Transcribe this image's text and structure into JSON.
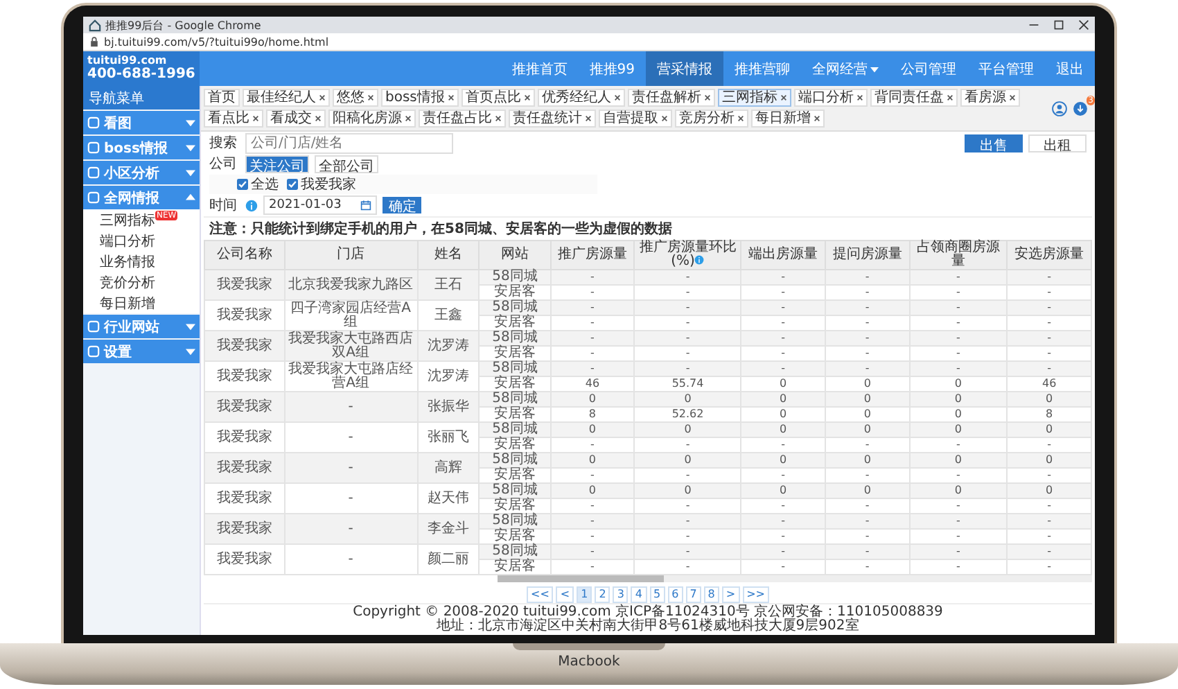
{
  "browser": {
    "title": "推推99后台 - Google Chrome",
    "url": "bj.tuitui99.com/v5/?tuitui99o/home.html"
  },
  "logo": {
    "brand": "tuitui99.com",
    "phone": "400-688-1996"
  },
  "nav": [
    {
      "label": "推推首页",
      "selected": false,
      "dropdown": false
    },
    {
      "label": "推推99",
      "selected": false,
      "dropdown": false
    },
    {
      "label": "营采情报",
      "selected": true,
      "dropdown": false
    },
    {
      "label": "推推营聊",
      "selected": false,
      "dropdown": false
    },
    {
      "label": "全网经营",
      "selected": false,
      "dropdown": true
    },
    {
      "label": "公司管理",
      "selected": false,
      "dropdown": false
    },
    {
      "label": "平台管理",
      "selected": false,
      "dropdown": false
    },
    {
      "label": "退出",
      "selected": false,
      "dropdown": false
    }
  ],
  "sidebar": {
    "title": "导航菜单",
    "items": [
      {
        "label": "看图",
        "expanded": false
      },
      {
        "label": "boss情报",
        "expanded": false
      },
      {
        "label": "小区分析",
        "expanded": false
      },
      {
        "label": "全网情报",
        "expanded": true,
        "children": [
          {
            "label": "三网指标",
            "badge": "NEW"
          },
          {
            "label": "端口分析"
          },
          {
            "label": "业务情报"
          },
          {
            "label": "竞价分析"
          },
          {
            "label": "每日新增"
          }
        ]
      },
      {
        "label": "行业网站",
        "expanded": false
      },
      {
        "label": "设置",
        "expanded": false
      }
    ]
  },
  "tabs": [
    {
      "label": "首页",
      "selected": false,
      "closable": false
    },
    {
      "label": "最佳经纪人",
      "selected": false,
      "closable": true
    },
    {
      "label": "悠悠",
      "selected": false,
      "closable": true
    },
    {
      "label": "boss情报",
      "selected": false,
      "closable": true
    },
    {
      "label": "首页点比",
      "selected": false,
      "closable": true
    },
    {
      "label": "优秀经纪人",
      "selected": false,
      "closable": true
    },
    {
      "label": "责任盘解析",
      "selected": false,
      "closable": true
    },
    {
      "label": "三网指标",
      "selected": true,
      "closable": true
    },
    {
      "label": "端口分析",
      "selected": false,
      "closable": true
    },
    {
      "label": "背同责任盘",
      "selected": false,
      "closable": true
    },
    {
      "label": "看房源",
      "selected": false,
      "closable": true
    },
    {
      "label": "看点比",
      "selected": false,
      "closable": true
    },
    {
      "label": "看成交",
      "selected": false,
      "closable": true
    },
    {
      "label": "阳稿化房源",
      "selected": false,
      "closable": true
    },
    {
      "label": "责任盘占比",
      "selected": false,
      "closable": true
    },
    {
      "label": "责任盘统计",
      "selected": false,
      "closable": true
    },
    {
      "label": "自营提取",
      "selected": false,
      "closable": true
    },
    {
      "label": "竞房分析",
      "selected": false,
      "closable": true
    },
    {
      "label": "每日新增",
      "selected": false,
      "closable": true
    }
  ],
  "notification_badge": "3",
  "filters": {
    "search": {
      "label": "搜索",
      "placeholder": "公司/门店/姓名"
    },
    "company": {
      "label": "公司",
      "options": [
        {
          "label": "关注公司",
          "selected": true
        },
        {
          "label": "全部公司",
          "selected": false
        }
      ]
    },
    "checkboxes": [
      {
        "label": "全选",
        "checked": true
      },
      {
        "label": "我爱我家",
        "checked": true
      }
    ],
    "time": {
      "label": "时间",
      "value": "2021-01-03",
      "confirm": "确定"
    }
  },
  "mode_buttons": [
    {
      "label": "出售",
      "selected": true
    },
    {
      "label": "出租",
      "selected": false
    }
  ],
  "note": "注意：只能统计到绑定手机的用户，在58同城、安居客的一些为虚假的数据",
  "table": {
    "columns": [
      {
        "label": "公司名称",
        "info": false
      },
      {
        "label": "门店",
        "info": false
      },
      {
        "label": "姓名",
        "info": false
      },
      {
        "label": "网站",
        "info": false
      },
      {
        "label": "推广房源量",
        "info": false
      },
      {
        "label": "推广房源量环比(%)",
        "info": true
      },
      {
        "label": "端出房源量",
        "info": false
      },
      {
        "label": "提问房源量",
        "info": false
      },
      {
        "label": "占领商圈房源量",
        "info": false
      },
      {
        "label": "安选房源量",
        "info": false
      }
    ],
    "rows": [
      {
        "company": "我爱我家",
        "store": "北京我爱我家九路区",
        "name": "王石",
        "sites": [
          {
            "site": "58同城",
            "values": [
              "-",
              "-",
              "-",
              "-",
              "-",
              "-"
            ]
          },
          {
            "site": "安居客",
            "values": [
              "-",
              "-",
              "-",
              "-",
              "-",
              "-"
            ]
          }
        ]
      },
      {
        "company": "我爱我家",
        "store": "四子湾家园店经营A组",
        "name": "王鑫",
        "sites": [
          {
            "site": "58同城",
            "values": [
              "-",
              "-",
              "-",
              "-",
              "-",
              "-"
            ]
          },
          {
            "site": "安居客",
            "values": [
              "-",
              "-",
              "-",
              "-",
              "-",
              "-"
            ]
          }
        ]
      },
      {
        "company": "我爱我家",
        "store": "我爱我家大屯路西店双A组",
        "name": "沈罗涛",
        "sites": [
          {
            "site": "58同城",
            "values": [
              "-",
              "-",
              "-",
              "-",
              "-",
              "-"
            ]
          },
          {
            "site": "安居客",
            "values": [
              "-",
              "-",
              "-",
              "-",
              "-",
              "-"
            ]
          }
        ]
      },
      {
        "company": "我爱我家",
        "store": "我爱我家大屯路店经营A组",
        "name": "沈罗涛",
        "sites": [
          {
            "site": "58同城",
            "values": [
              "-",
              "-",
              "-",
              "-",
              "-",
              "-"
            ]
          },
          {
            "site": "安居客",
            "values": [
              "46",
              "55.74",
              "0",
              "0",
              "0",
              "46"
            ]
          }
        ]
      },
      {
        "company": "我爱我家",
        "store": "-",
        "name": "张振华",
        "sites": [
          {
            "site": "58同城",
            "values": [
              "0",
              "0",
              "0",
              "0",
              "0",
              "0"
            ]
          },
          {
            "site": "安居客",
            "values": [
              "8",
              "52.62",
              "0",
              "0",
              "0",
              "8"
            ]
          }
        ]
      },
      {
        "company": "我爱我家",
        "store": "-",
        "name": "张丽飞",
        "sites": [
          {
            "site": "58同城",
            "values": [
              "0",
              "0",
              "0",
              "0",
              "0",
              "0"
            ]
          },
          {
            "site": "安居客",
            "values": [
              "-",
              "-",
              "-",
              "-",
              "-",
              "-"
            ]
          }
        ]
      },
      {
        "company": "我爱我家",
        "store": "-",
        "name": "高辉",
        "sites": [
          {
            "site": "58同城",
            "values": [
              "0",
              "0",
              "0",
              "0",
              "0",
              "0"
            ]
          },
          {
            "site": "安居客",
            "values": [
              "-",
              "-",
              "-",
              "-",
              "-",
              "-"
            ]
          }
        ]
      },
      {
        "company": "我爱我家",
        "store": "-",
        "name": "赵天伟",
        "sites": [
          {
            "site": "58同城",
            "values": [
              "0",
              "0",
              "0",
              "0",
              "0",
              "0"
            ]
          },
          {
            "site": "安居客",
            "values": [
              "-",
              "-",
              "-",
              "-",
              "-",
              "-"
            ]
          }
        ]
      },
      {
        "company": "我爱我家",
        "store": "-",
        "name": "李金斗",
        "sites": [
          {
            "site": "58同城",
            "values": [
              "-",
              "-",
              "-",
              "-",
              "-",
              "-"
            ]
          },
          {
            "site": "安居客",
            "values": [
              "-",
              "-",
              "-",
              "-",
              "-",
              "-"
            ]
          }
        ]
      },
      {
        "company": "我爱我家",
        "store": "-",
        "name": "颜二丽",
        "sites": [
          {
            "site": "58同城",
            "values": [
              "-",
              "-",
              "-",
              "-",
              "-",
              "-"
            ]
          },
          {
            "site": "安居客",
            "values": [
              "-",
              "-",
              "-",
              "-",
              "-",
              "-"
            ]
          }
        ]
      }
    ]
  },
  "pager": [
    {
      "label": "<<",
      "selected": false
    },
    {
      "label": "<",
      "selected": false
    },
    {
      "label": "1",
      "selected": true
    },
    {
      "label": "2",
      "selected": false
    },
    {
      "label": "3",
      "selected": false
    },
    {
      "label": "4",
      "selected": false
    },
    {
      "label": "5",
      "selected": false
    },
    {
      "label": "6",
      "selected": false
    },
    {
      "label": "7",
      "selected": false
    },
    {
      "label": "8",
      "selected": false
    },
    {
      "label": ">",
      "selected": false
    },
    {
      "label": ">>",
      "selected": false
    }
  ],
  "footer": {
    "copyright": "Copyright © 2008-2020 tuitui99.com 京ICP备11024310号 京公网安备：110105008839",
    "address": "地址：北京市海淀区中关村南大街甲8号61楼威地科技大厦9层902室"
  },
  "device_label": "Macbook"
}
